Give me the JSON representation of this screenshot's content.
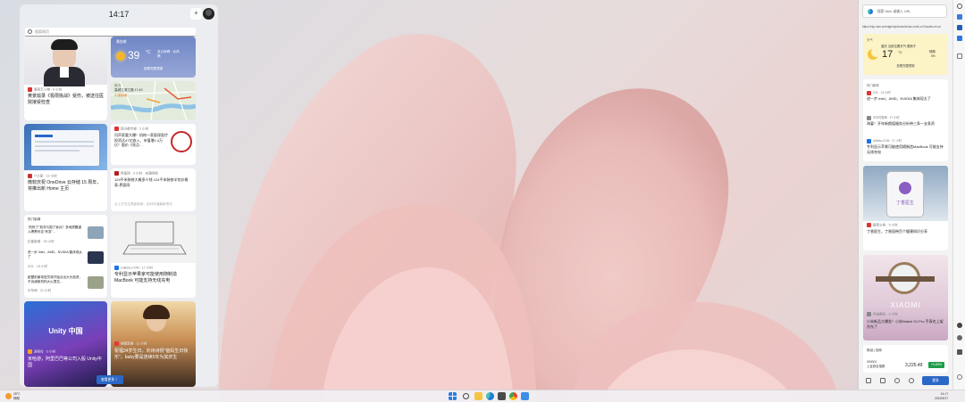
{
  "widgets": {
    "time": "14:17",
    "add_button": "+",
    "search_placeholder": "搜索网页",
    "cards": [
      {
        "source": "爱奇艺人物 · 6 小时",
        "title": "黄景瑜录《极限挑战》受伤，被送往医院接受检查"
      },
      {
        "source": "雅加城",
        "temp": "39",
        "unit": "°C",
        "condition": "多云转晴 · 北风\n晴",
        "link": "查看完整预报"
      },
      {
        "source": "路况",
        "title": "高城江滨江路 17:49",
        "status": "中度拥堵"
      },
      {
        "source": "IT之家 · 12 小时",
        "title": "微软庆祝 OneDrive 云存储 15 周年，将推出新 Home 主页"
      },
      {
        "source": "南方都市报 · 2 小时",
        "title": "闫声家要大爆！机构一家医保医疗投资达47亿收入、市值增1.4万亿！股价《亮点…"
      },
      {
        "source": "界面网 · 3 小时 · 来源网络",
        "title": "124平米装修大概多少钱 124平米装修半包价格表-界面网",
        "footer": "点上方关注界面新闻，实时传递最新资讯"
      },
      {
        "header": "热门新闻",
        "items": [
          {
            "title": "\"热死了\"到决与国了哀兵？多地提醒谨入嗯嗯讯告\"来变\"...",
            "meta": "红星新闻 · 33 小时"
          },
          {
            "title": "进一步 Intel、AMD、NVIDIA 集体现太了",
            "meta": "ZOL · 13 小时"
          },
          {
            "title": "欧盟前景将官员将开始业出大头投资，不诉诸家机构大火提拉...",
            "meta": "中华网 · 21 小时"
          }
        ]
      },
      {
        "source": "cnBeta.COM · 17 小时",
        "title": "专利显示苹果家可能使用随制造MacBook 可能支持无线充电"
      },
      {
        "source": "游研社 · 3 小时",
        "title": "米哈游，阿里巴巴等公司入股 Unity中国",
        "banner": "Unity 中国"
      },
      {
        "source": "搜狐新闻 · 11 小时",
        "title": "祝福34岁生日，刘诗诗祝\"爸妈生日快乐\"，baby要是连续5年为其庆生"
      }
    ],
    "more_label": "查看更多 〉"
  },
  "right_panel": {
    "search_placeholder": "搜索 Web 或输入 URL",
    "url": "https://ntp.msn.cn/edge/ntp/news/china-cn/zh-cn?locale=zh-cn",
    "weather": {
      "label": "天气",
      "location": "重庆 当前位置天气 更新于",
      "temp": "17",
      "unit": "°C",
      "condition": "晴朗\n0%",
      "link": "查看完整预报"
    },
    "hot": {
      "label": "热门新闻",
      "items": [
        {
          "meta": "ZOL · 13 小时",
          "title": "进一步 Intel、AMD、NVIDIA 集体现太了"
        },
        {
          "meta": "中华时报网 · 17 小时",
          "title": "海宴！开年新颜值服务分析带三条一支条资"
        },
        {
          "meta": "cnBeta.COM · 17 小时",
          "title": "专利显示苹果可能使用随制造MacBook 可能支持无线充电"
        }
      ]
    },
    "card1": {
      "source": "鹿宝头条 · 5 小时",
      "title": "丁香医生，丁香园带百个健康知识分享",
      "banner": "丁香医生"
    },
    "card2": {
      "source": "科技数码 · 9 小时",
      "title": "小米新品大爆发！小米Watch S1 Pro 手表也上架京东了",
      "banner": "XIAOMI"
    },
    "ticker": {
      "label": "财经 | 指年",
      "code": "000001\n上证综合指数",
      "value": "3,225.49",
      "change": "+0.69%"
    },
    "more_label": "更多"
  },
  "taskbar": {
    "weather": "28°C\n晴朗",
    "clock": "14:17\n2022/6/17"
  }
}
